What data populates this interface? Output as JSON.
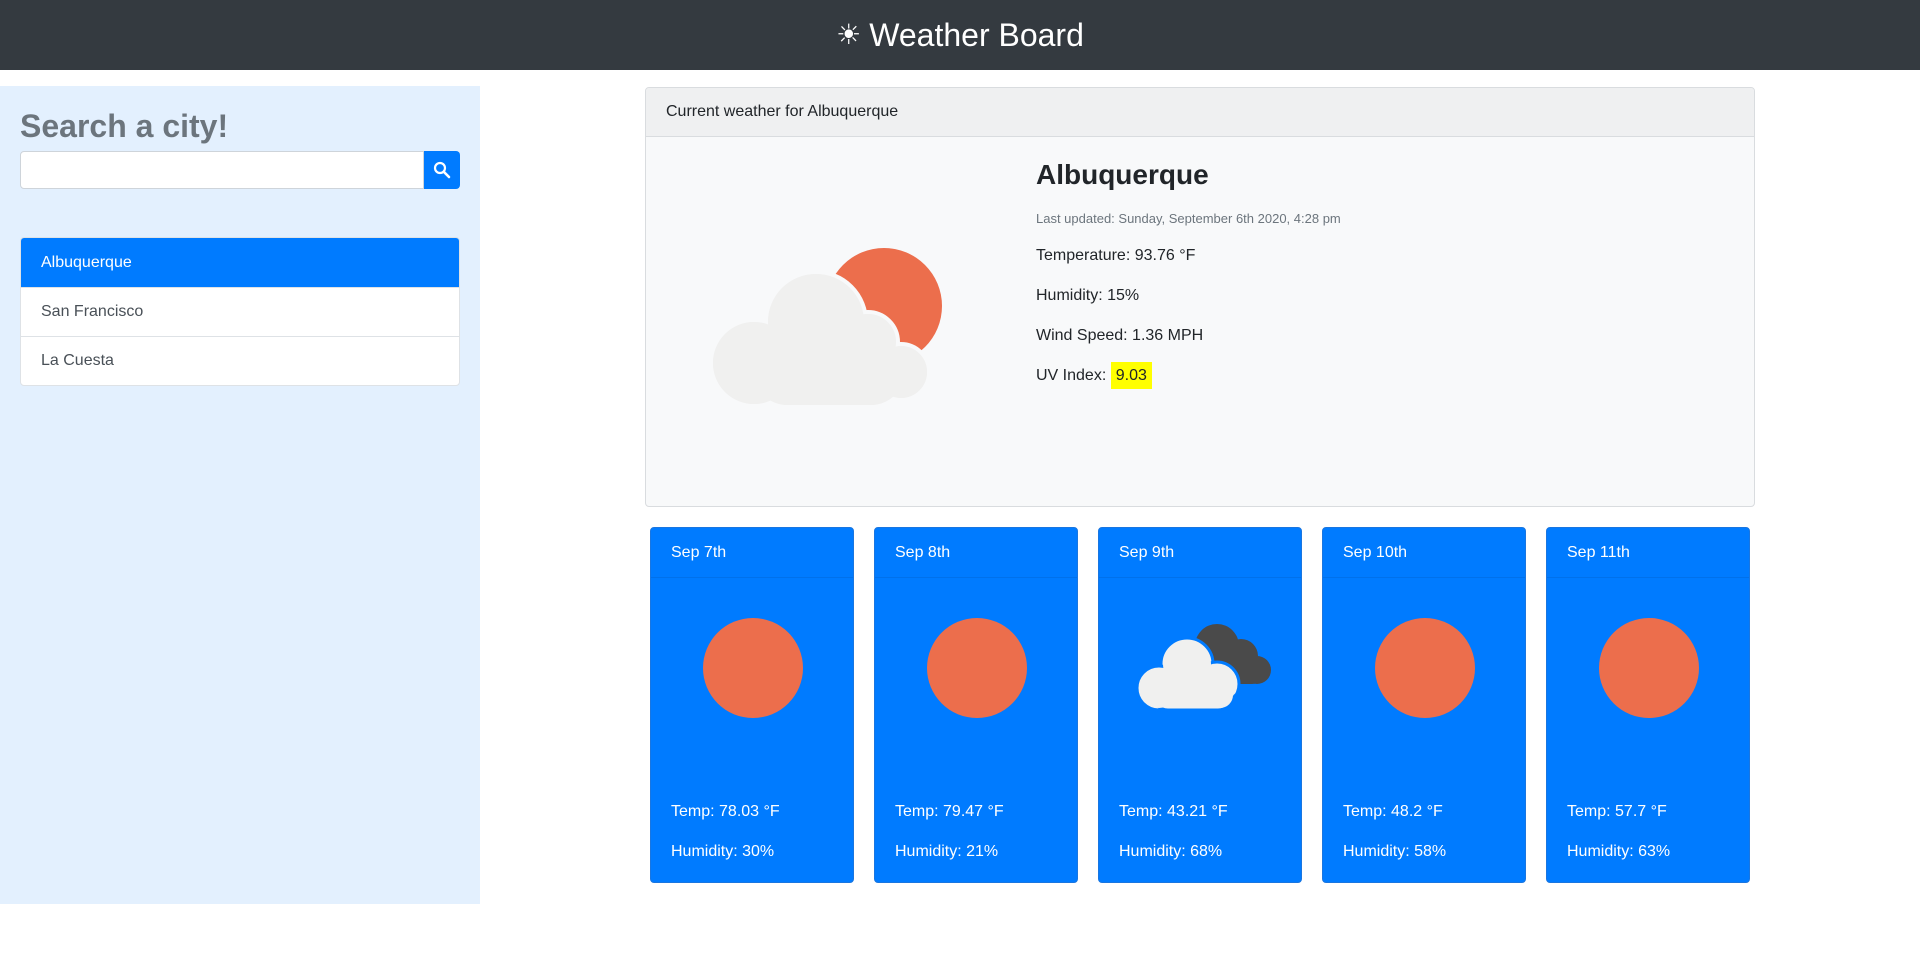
{
  "header": {
    "title": "Weather Board",
    "icon": "sun-icon"
  },
  "sidebar": {
    "heading": "Search a city!",
    "search": {
      "value": "",
      "placeholder": ""
    },
    "cities": [
      {
        "label": "Albuquerque",
        "active": true
      },
      {
        "label": "San Francisco",
        "active": false
      },
      {
        "label": "La Cuesta",
        "active": false
      }
    ]
  },
  "current": {
    "header": "Current weather for Albuquerque",
    "city": "Albuquerque",
    "updated": "Last updated: Sunday, September 6th 2020, 4:28 pm",
    "temperature": "Temperature: 93.76 °F",
    "humidity": "Humidity: 15%",
    "wind": "Wind Speed: 1.36 MPH",
    "uv_label": "UV Index:",
    "uv_value": "9.03",
    "icon": "partly-cloudy-icon"
  },
  "forecast": [
    {
      "date": "Sep 7th",
      "temp": "Temp: 78.03 °F",
      "humidity": "Humidity: 30%",
      "icon": "sun-icon"
    },
    {
      "date": "Sep 8th",
      "temp": "Temp: 79.47 °F",
      "humidity": "Humidity: 21%",
      "icon": "sun-icon"
    },
    {
      "date": "Sep 9th",
      "temp": "Temp: 43.21 °F",
      "humidity": "Humidity: 68%",
      "icon": "cloud-icon"
    },
    {
      "date": "Sep 10th",
      "temp": "Temp: 48.2 °F",
      "humidity": "Humidity: 58%",
      "icon": "sun-icon"
    },
    {
      "date": "Sep 11th",
      "temp": "Temp: 57.7 °F",
      "humidity": "Humidity: 63%",
      "icon": "sun-icon"
    }
  ],
  "colors": {
    "navbar": "#343a40",
    "accent": "#007bff",
    "sidebar_bg": "#e3f0fe",
    "sun": "#ec6e4c",
    "uv_highlight": "#ffff00"
  }
}
